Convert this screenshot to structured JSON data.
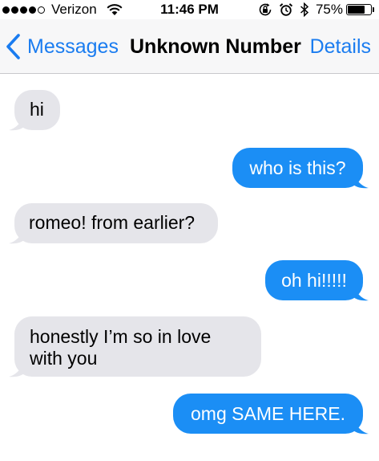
{
  "status_bar": {
    "carrier": "Verizon",
    "signal_bars": 4,
    "signal_max": 5,
    "time": "11:46 PM",
    "battery_percent": "75%",
    "battery_level": 0.75,
    "icons": [
      "wifi-icon",
      "orientation-lock-icon",
      "alarm-icon",
      "bluetooth-icon",
      "battery-icon"
    ]
  },
  "nav": {
    "back_label": "Messages",
    "title": "Unknown Number",
    "details_label": "Details"
  },
  "colors": {
    "accent": "#1a7cf0",
    "incoming_bubble": "#e5e5ea",
    "outgoing_bubble": "#1b8ef5"
  },
  "messages": [
    {
      "direction": "incoming",
      "text": "hi"
    },
    {
      "direction": "outgoing",
      "text": "who is this?"
    },
    {
      "direction": "incoming",
      "text": "romeo! from earlier?"
    },
    {
      "direction": "outgoing",
      "text": "oh hi!!!!!"
    },
    {
      "direction": "incoming",
      "text": "honestly I’m so in love with you"
    },
    {
      "direction": "outgoing",
      "text": "omg SAME HERE."
    }
  ]
}
